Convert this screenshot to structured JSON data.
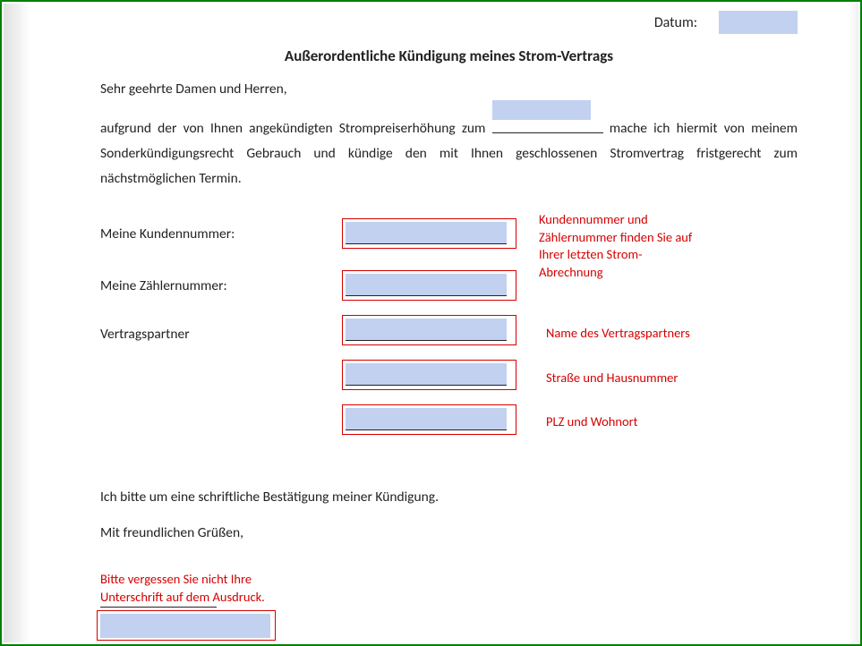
{
  "date": {
    "label": "Datum:"
  },
  "title": "Außerordentliche Kündigung meines Strom-Vertrags",
  "salutation": "Sehr geehrte Damen und Herren,",
  "para_before_date": "aufgrund der von Ihnen angekündigten Strompreiserhöhung zum ",
  "para_after_date": " mache ich hiermit von meinem Sonderkündigungsrecht Gebrauch und kündige den mit Ihnen geschlossenen Stromvertrag fristgerecht zum nächstmöglichen Termin.",
  "fields": {
    "kundennummer_label": "Meine Kundennummer:",
    "zaehlernummer_label": "Meine Zählernummer:",
    "vertragspartner_label": "Vertragspartner"
  },
  "hints": {
    "kundenzaehler": "Kundennummer und Zählernummer finden Sie auf Ihrer letzten Strom-Abrechnung",
    "name": "Name des Vertragspartners",
    "strasse": "Straße und Hausnummer",
    "plz": "PLZ und Wohnort",
    "signatur": "Bitte vergessen Sie nicht Ihre Unterschrift auf dem Ausdruck."
  },
  "confirm": "Ich bitte um eine schriftliche Bestätigung meiner Kündigung.",
  "closing": "Mit freundlichen Grüßen,"
}
